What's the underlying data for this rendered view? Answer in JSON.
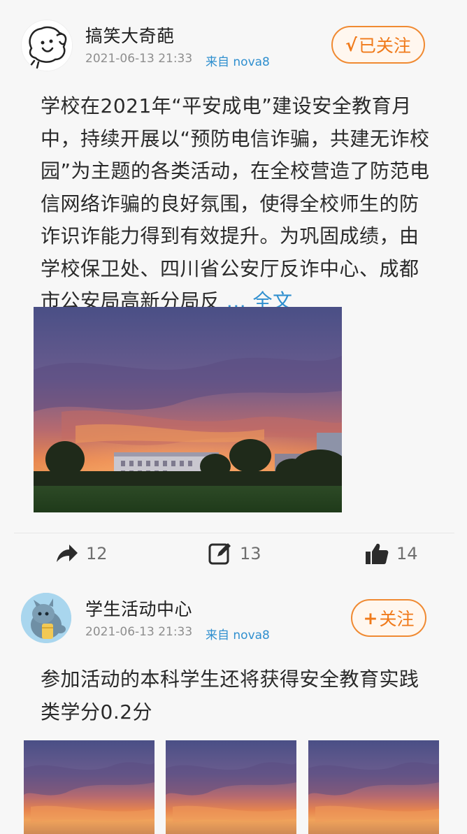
{
  "posts": [
    {
      "username": "搞笑大奇葩",
      "time": "2021-06-13 21:33",
      "source": "来自 nova8",
      "follow": {
        "mark": "√",
        "label": "已关注"
      },
      "text": "学校在2021年“平安成电”建设安全教育月中，持续开展以“预防电信诈骗，共建无诈校园”为主题的各类活动，在全校营造了防范电信网络诈骗的良好氛围，使得全校师生的防诈识诈能力得到有效提升。为巩固成绩，由学校保卫处、四川省公安厅反诈中心、成都市公安局高新分局反",
      "more": "... 全文",
      "actions": {
        "repost": "12",
        "comment": "13",
        "like": "14"
      }
    },
    {
      "username": "学生活动中心",
      "time": "2021-06-13 21:33",
      "source": "来自 nova8",
      "follow": {
        "mark": "+",
        "label": "关注"
      },
      "text": "参加活动的本科学生还将获得安全教育实践类学分0.2分"
    }
  ]
}
